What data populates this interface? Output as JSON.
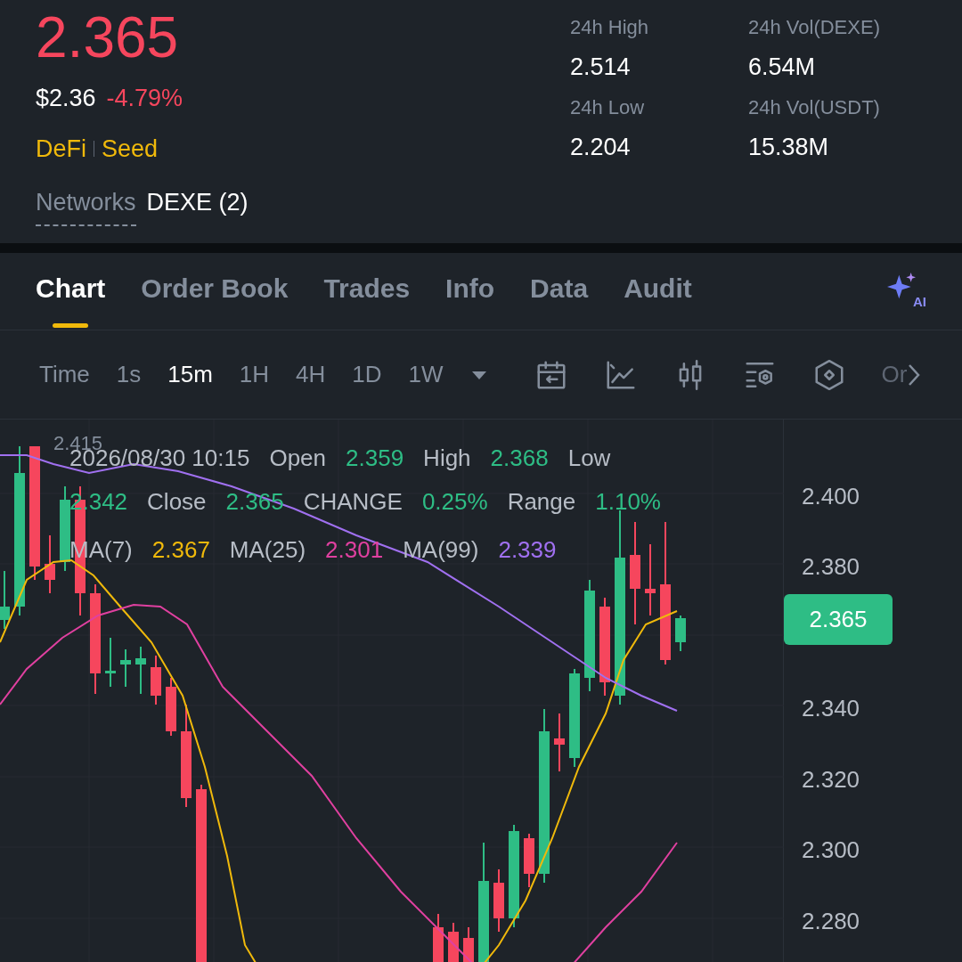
{
  "ticker": {
    "price": "2.365",
    "fiat_price": "$2.36",
    "change": "-4.79%",
    "tags": [
      "DeFi",
      "Seed"
    ],
    "networks_label": "Networks",
    "networks_value": "DEXE (2)"
  },
  "stats": [
    {
      "label": "24h High",
      "value": "2.514"
    },
    {
      "label": "24h Vol(DEXE)",
      "value": "6.54M"
    },
    {
      "label": "24h Low",
      "value": "2.204"
    },
    {
      "label": "24h Vol(USDT)",
      "value": "15.38M"
    }
  ],
  "tabs": [
    {
      "label": "Chart",
      "selected": true
    },
    {
      "label": "Order Book",
      "selected": false
    },
    {
      "label": "Trades",
      "selected": false
    },
    {
      "label": "Info",
      "selected": false
    },
    {
      "label": "Data",
      "selected": false
    },
    {
      "label": "Audit",
      "selected": false
    }
  ],
  "ai_button": {
    "label": "AI"
  },
  "intervals": [
    {
      "label": "Time",
      "selected": false
    },
    {
      "label": "1s",
      "selected": false
    },
    {
      "label": "15m",
      "selected": true
    },
    {
      "label": "1H",
      "selected": false
    },
    {
      "label": "4H",
      "selected": false
    },
    {
      "label": "1D",
      "selected": false
    },
    {
      "label": "1W",
      "selected": false
    }
  ],
  "toolbar_overflow": "Or",
  "chart": {
    "high_marker": "2.415",
    "legend_row1": [
      {
        "kind": "label",
        "text": "2026/08/30 10:15"
      },
      {
        "kind": "label",
        "text": "Open"
      },
      {
        "kind": "value",
        "text": "2.359"
      },
      {
        "kind": "label",
        "text": "High"
      },
      {
        "kind": "value",
        "text": "2.368"
      },
      {
        "kind": "label",
        "text": "Low"
      }
    ],
    "legend_row2": [
      {
        "kind": "value",
        "text": "2.342"
      },
      {
        "kind": "label",
        "text": "Close"
      },
      {
        "kind": "value",
        "text": "2.365"
      },
      {
        "kind": "label",
        "text": "CHANGE"
      },
      {
        "kind": "value",
        "text": "0.25%"
      },
      {
        "kind": "label",
        "text": "Range"
      },
      {
        "kind": "value",
        "text": "1.10%"
      }
    ],
    "moving_averages": [
      {
        "label": "MA(7)",
        "value": "2.367",
        "color": "#f0b90b"
      },
      {
        "label": "MA(25)",
        "value": "2.301",
        "color": "#e040a0"
      },
      {
        "label": "MA(99)",
        "value": "2.339",
        "color": "#a070f0"
      }
    ],
    "y_axis": [
      "2.400",
      "2.380",
      "2.340",
      "2.320",
      "2.300",
      "2.280"
    ],
    "last_price": "2.365"
  }
}
